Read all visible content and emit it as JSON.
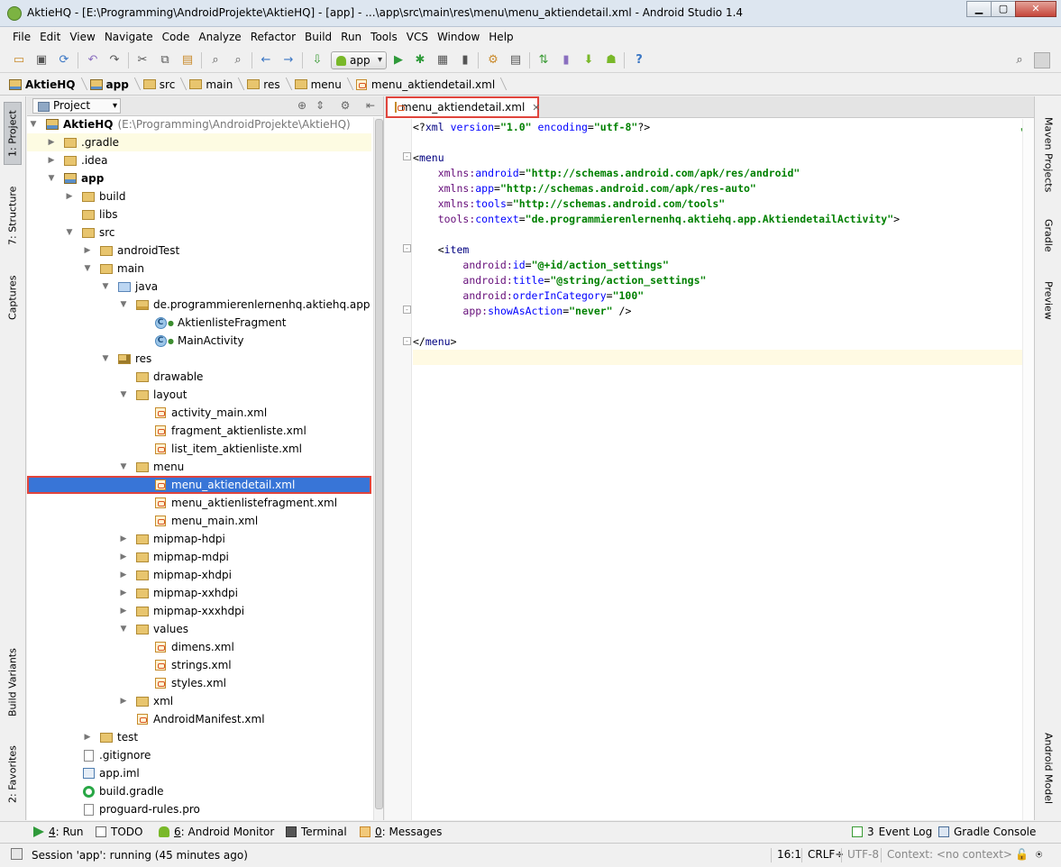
{
  "window": {
    "title": "AktieHQ - [E:\\Programming\\AndroidProjekte\\AktieHQ] - [app] - ...\\app\\src\\main\\res\\menu\\menu_aktiendetail.xml - Android Studio 1.4",
    "controls": [
      "minimize-icon",
      "maximize-icon",
      "close-icon"
    ]
  },
  "menubar": [
    "File",
    "Edit",
    "View",
    "Navigate",
    "Code",
    "Analyze",
    "Refactor",
    "Build",
    "Run",
    "Tools",
    "VCS",
    "Window",
    "Help"
  ],
  "toolbar": {
    "run_config": "app"
  },
  "breadcrumb": [
    "AktieHQ",
    "app",
    "src",
    "main",
    "res",
    "menu",
    "menu_aktiendetail.xml"
  ],
  "left_strip": {
    "project": "1: Project",
    "structure": "7: Structure",
    "captures": "Captures",
    "build_variants": "Build Variants",
    "favorites": "2: Favorites"
  },
  "right_strip": {
    "maven": "Maven Projects",
    "gradle": "Gradle",
    "preview": "Preview",
    "android_model": "Android Model"
  },
  "project_panel": {
    "selector": "Project",
    "tree": [
      {
        "label": "AktieHQ",
        "path": "(E:\\Programming\\AndroidProjekte\\AktieHQ)",
        "depth": 0,
        "arrow": "▼",
        "icon": "mod",
        "bold": true
      },
      {
        "label": ".gradle",
        "depth": 1,
        "arrow": "▶",
        "icon": "folder",
        "highlight": true
      },
      {
        "label": ".idea",
        "depth": 1,
        "arrow": "▶",
        "icon": "folder"
      },
      {
        "label": "app",
        "depth": 1,
        "arrow": "▼",
        "icon": "mod",
        "bold": true
      },
      {
        "label": "build",
        "depth": 2,
        "arrow": "▶",
        "icon": "folder"
      },
      {
        "label": "libs",
        "depth": 2,
        "arrow": "",
        "icon": "folder"
      },
      {
        "label": "src",
        "depth": 2,
        "arrow": "▼",
        "icon": "folder"
      },
      {
        "label": "androidTest",
        "depth": 3,
        "arrow": "▶",
        "icon": "folder"
      },
      {
        "label": "main",
        "depth": 3,
        "arrow": "▼",
        "icon": "folder"
      },
      {
        "label": "java",
        "depth": 4,
        "arrow": "▼",
        "icon": "src"
      },
      {
        "label": "de.programmierenlernenhq.aktiehq.app",
        "depth": 5,
        "arrow": "▼",
        "icon": "pkg"
      },
      {
        "label": "AktienlisteFragment",
        "depth": 6,
        "arrow": "",
        "icon": "class"
      },
      {
        "label": "MainActivity",
        "depth": 6,
        "arrow": "",
        "icon": "class"
      },
      {
        "label": "res",
        "depth": 4,
        "arrow": "▼",
        "icon": "res"
      },
      {
        "label": "drawable",
        "depth": 5,
        "arrow": "",
        "icon": "folder"
      },
      {
        "label": "layout",
        "depth": 5,
        "arrow": "▼",
        "icon": "folder"
      },
      {
        "label": "activity_main.xml",
        "depth": 6,
        "arrow": "",
        "icon": "xml"
      },
      {
        "label": "fragment_aktienliste.xml",
        "depth": 6,
        "arrow": "",
        "icon": "xml"
      },
      {
        "label": "list_item_aktienliste.xml",
        "depth": 6,
        "arrow": "",
        "icon": "xml"
      },
      {
        "label": "menu",
        "depth": 5,
        "arrow": "▼",
        "icon": "folder"
      },
      {
        "label": "menu_aktiendetail.xml",
        "depth": 6,
        "arrow": "",
        "icon": "xml",
        "selected": true
      },
      {
        "label": "menu_aktienlistefragment.xml",
        "depth": 6,
        "arrow": "",
        "icon": "xml"
      },
      {
        "label": "menu_main.xml",
        "depth": 6,
        "arrow": "",
        "icon": "xml"
      },
      {
        "label": "mipmap-hdpi",
        "depth": 5,
        "arrow": "▶",
        "icon": "folder"
      },
      {
        "label": "mipmap-mdpi",
        "depth": 5,
        "arrow": "▶",
        "icon": "folder"
      },
      {
        "label": "mipmap-xhdpi",
        "depth": 5,
        "arrow": "▶",
        "icon": "folder"
      },
      {
        "label": "mipmap-xxhdpi",
        "depth": 5,
        "arrow": "▶",
        "icon": "folder"
      },
      {
        "label": "mipmap-xxxhdpi",
        "depth": 5,
        "arrow": "▶",
        "icon": "folder"
      },
      {
        "label": "values",
        "depth": 5,
        "arrow": "▼",
        "icon": "folder"
      },
      {
        "label": "dimens.xml",
        "depth": 6,
        "arrow": "",
        "icon": "xml"
      },
      {
        "label": "strings.xml",
        "depth": 6,
        "arrow": "",
        "icon": "xml"
      },
      {
        "label": "styles.xml",
        "depth": 6,
        "arrow": "",
        "icon": "xml"
      },
      {
        "label": "xml",
        "depth": 5,
        "arrow": "▶",
        "icon": "folder"
      },
      {
        "label": "AndroidManifest.xml",
        "depth": 5,
        "arrow": "",
        "icon": "xml"
      },
      {
        "label": "test",
        "depth": 3,
        "arrow": "▶",
        "icon": "folder"
      },
      {
        "label": ".gitignore",
        "depth": 2,
        "arrow": "",
        "icon": "file"
      },
      {
        "label": "app.iml",
        "depth": 2,
        "arrow": "",
        "icon": "iml"
      },
      {
        "label": "build.gradle",
        "depth": 2,
        "arrow": "",
        "icon": "gradle"
      },
      {
        "label": "proguard-rules.pro",
        "depth": 2,
        "arrow": "",
        "icon": "file"
      }
    ]
  },
  "editor": {
    "tab_label": "menu_aktiendetail.xml",
    "lines": [
      [
        [
          "pl",
          "<?"
        ],
        [
          "tg",
          "xml "
        ],
        [
          "an",
          "version"
        ],
        [
          "pl",
          "="
        ],
        [
          "av",
          "\"1.0\""
        ],
        [
          "pl",
          " "
        ],
        [
          "an",
          "encoding"
        ],
        [
          "pl",
          "="
        ],
        [
          "av",
          "\"utf-8\""
        ],
        [
          "pl",
          "?>"
        ]
      ],
      [],
      [
        [
          "pl",
          "<"
        ],
        [
          "tg",
          "menu"
        ]
      ],
      [
        [
          "pl",
          "    "
        ],
        [
          "ans",
          "xmlns:"
        ],
        [
          "an",
          "android"
        ],
        [
          "pl",
          "="
        ],
        [
          "av",
          "\"http://schemas.android.com/apk/res/android\""
        ]
      ],
      [
        [
          "pl",
          "    "
        ],
        [
          "ans",
          "xmlns:"
        ],
        [
          "an",
          "app"
        ],
        [
          "pl",
          "="
        ],
        [
          "av",
          "\"http://schemas.android.com/apk/res-auto\""
        ]
      ],
      [
        [
          "pl",
          "    "
        ],
        [
          "ans",
          "xmlns:"
        ],
        [
          "an",
          "tools"
        ],
        [
          "pl",
          "="
        ],
        [
          "av",
          "\"http://schemas.android.com/tools\""
        ]
      ],
      [
        [
          "pl",
          "    "
        ],
        [
          "ans",
          "tools:"
        ],
        [
          "an",
          "context"
        ],
        [
          "pl",
          "="
        ],
        [
          "av",
          "\"de.programmierenlernenhq.aktiehq.app.AktiendetailActivity\""
        ],
        [
          "pl",
          ">"
        ]
      ],
      [],
      [
        [
          "pl",
          "    <"
        ],
        [
          "tg",
          "item"
        ]
      ],
      [
        [
          "pl",
          "        "
        ],
        [
          "ans",
          "android:"
        ],
        [
          "an",
          "id"
        ],
        [
          "pl",
          "="
        ],
        [
          "av",
          "\"@+id/action_settings\""
        ]
      ],
      [
        [
          "pl",
          "        "
        ],
        [
          "ans",
          "android:"
        ],
        [
          "an",
          "title"
        ],
        [
          "pl",
          "="
        ],
        [
          "av",
          "\"@string/action_settings\""
        ]
      ],
      [
        [
          "pl",
          "        "
        ],
        [
          "ans",
          "android:"
        ],
        [
          "an",
          "orderInCategory"
        ],
        [
          "pl",
          "="
        ],
        [
          "av",
          "\"100\""
        ]
      ],
      [
        [
          "pl",
          "        "
        ],
        [
          "ans",
          "app:"
        ],
        [
          "an",
          "showAsAction"
        ],
        [
          "pl",
          "="
        ],
        [
          "av",
          "\"never\""
        ],
        [
          "pl",
          " />"
        ]
      ],
      [],
      [
        [
          "pl",
          "</"
        ],
        [
          "tg",
          "menu"
        ],
        [
          "pl",
          ">"
        ]
      ],
      []
    ]
  },
  "bottom_tools": [
    {
      "key": "4",
      "label": ": Run",
      "icon": "run-icon",
      "color": "#2f9a3a"
    },
    {
      "key": "",
      "label": "TODO",
      "icon": "todo-icon",
      "color": "#6b6b6b"
    },
    {
      "key": "6",
      "label": ": Android Monitor",
      "icon": "android-icon",
      "color": "#79b829"
    },
    {
      "key": "",
      "label": "Terminal",
      "icon": "terminal-icon",
      "color": "#555555"
    },
    {
      "key": "0",
      "label": ": Messages",
      "icon": "messages-icon",
      "color": "#c9892c"
    },
    {
      "key": "3",
      "label": "Event Log",
      "icon": "event-log-icon",
      "color": "#3a9b35"
    },
    {
      "key": "",
      "label": "Gradle Console",
      "icon": "gradle-console-icon",
      "color": "#4b6f9a"
    }
  ],
  "status": {
    "message": "Session 'app': running (45 minutes ago)",
    "position": "16:1",
    "line_sep": "CRLF÷",
    "encoding": "UTF-8",
    "context": "Context: <no context>"
  },
  "colors": {
    "selection": "#3875d7",
    "highlight_box": "#e0443c",
    "xml_tag": "#000080",
    "xml_attr": "#0000ff",
    "xml_ns": "#660e7a",
    "xml_value": "#008000"
  }
}
